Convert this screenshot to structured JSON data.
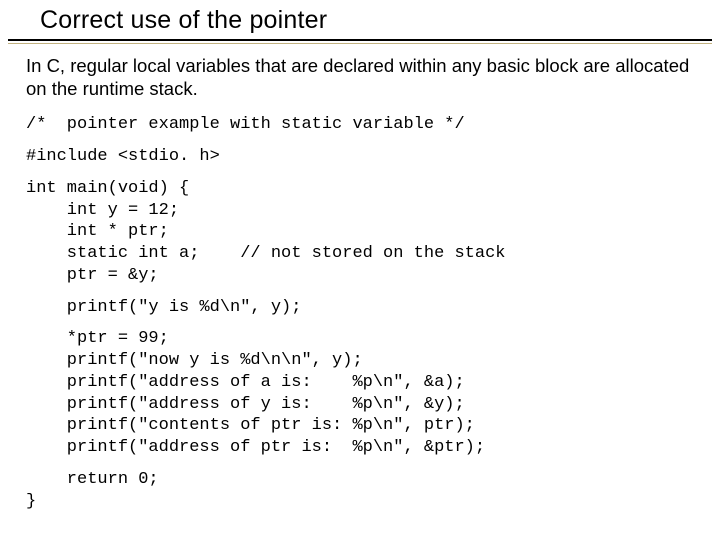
{
  "title": "Correct use of the pointer",
  "intro": "In C, regular local variables that are declared within any basic block are allocated on the runtime stack.",
  "code": {
    "c1": "/*  pointer example with static variable */",
    "c2": "#include <stdio. h>",
    "c3": "int main(void) {\n    int y = 12;\n    int * ptr;\n    static int a;    // not stored on the stack\n    ptr = &y;",
    "c4": "    printf(\"y is %d\\n\", y);",
    "c5": "    *ptr = 99;\n    printf(\"now y is %d\\n\\n\", y);\n    printf(\"address of a is:    %p\\n\", &a);\n    printf(\"address of y is:    %p\\n\", &y);\n    printf(\"contents of ptr is: %p\\n\", ptr);\n    printf(\"address of ptr is:  %p\\n\", &ptr);",
    "c6": "    return 0;\n}"
  }
}
